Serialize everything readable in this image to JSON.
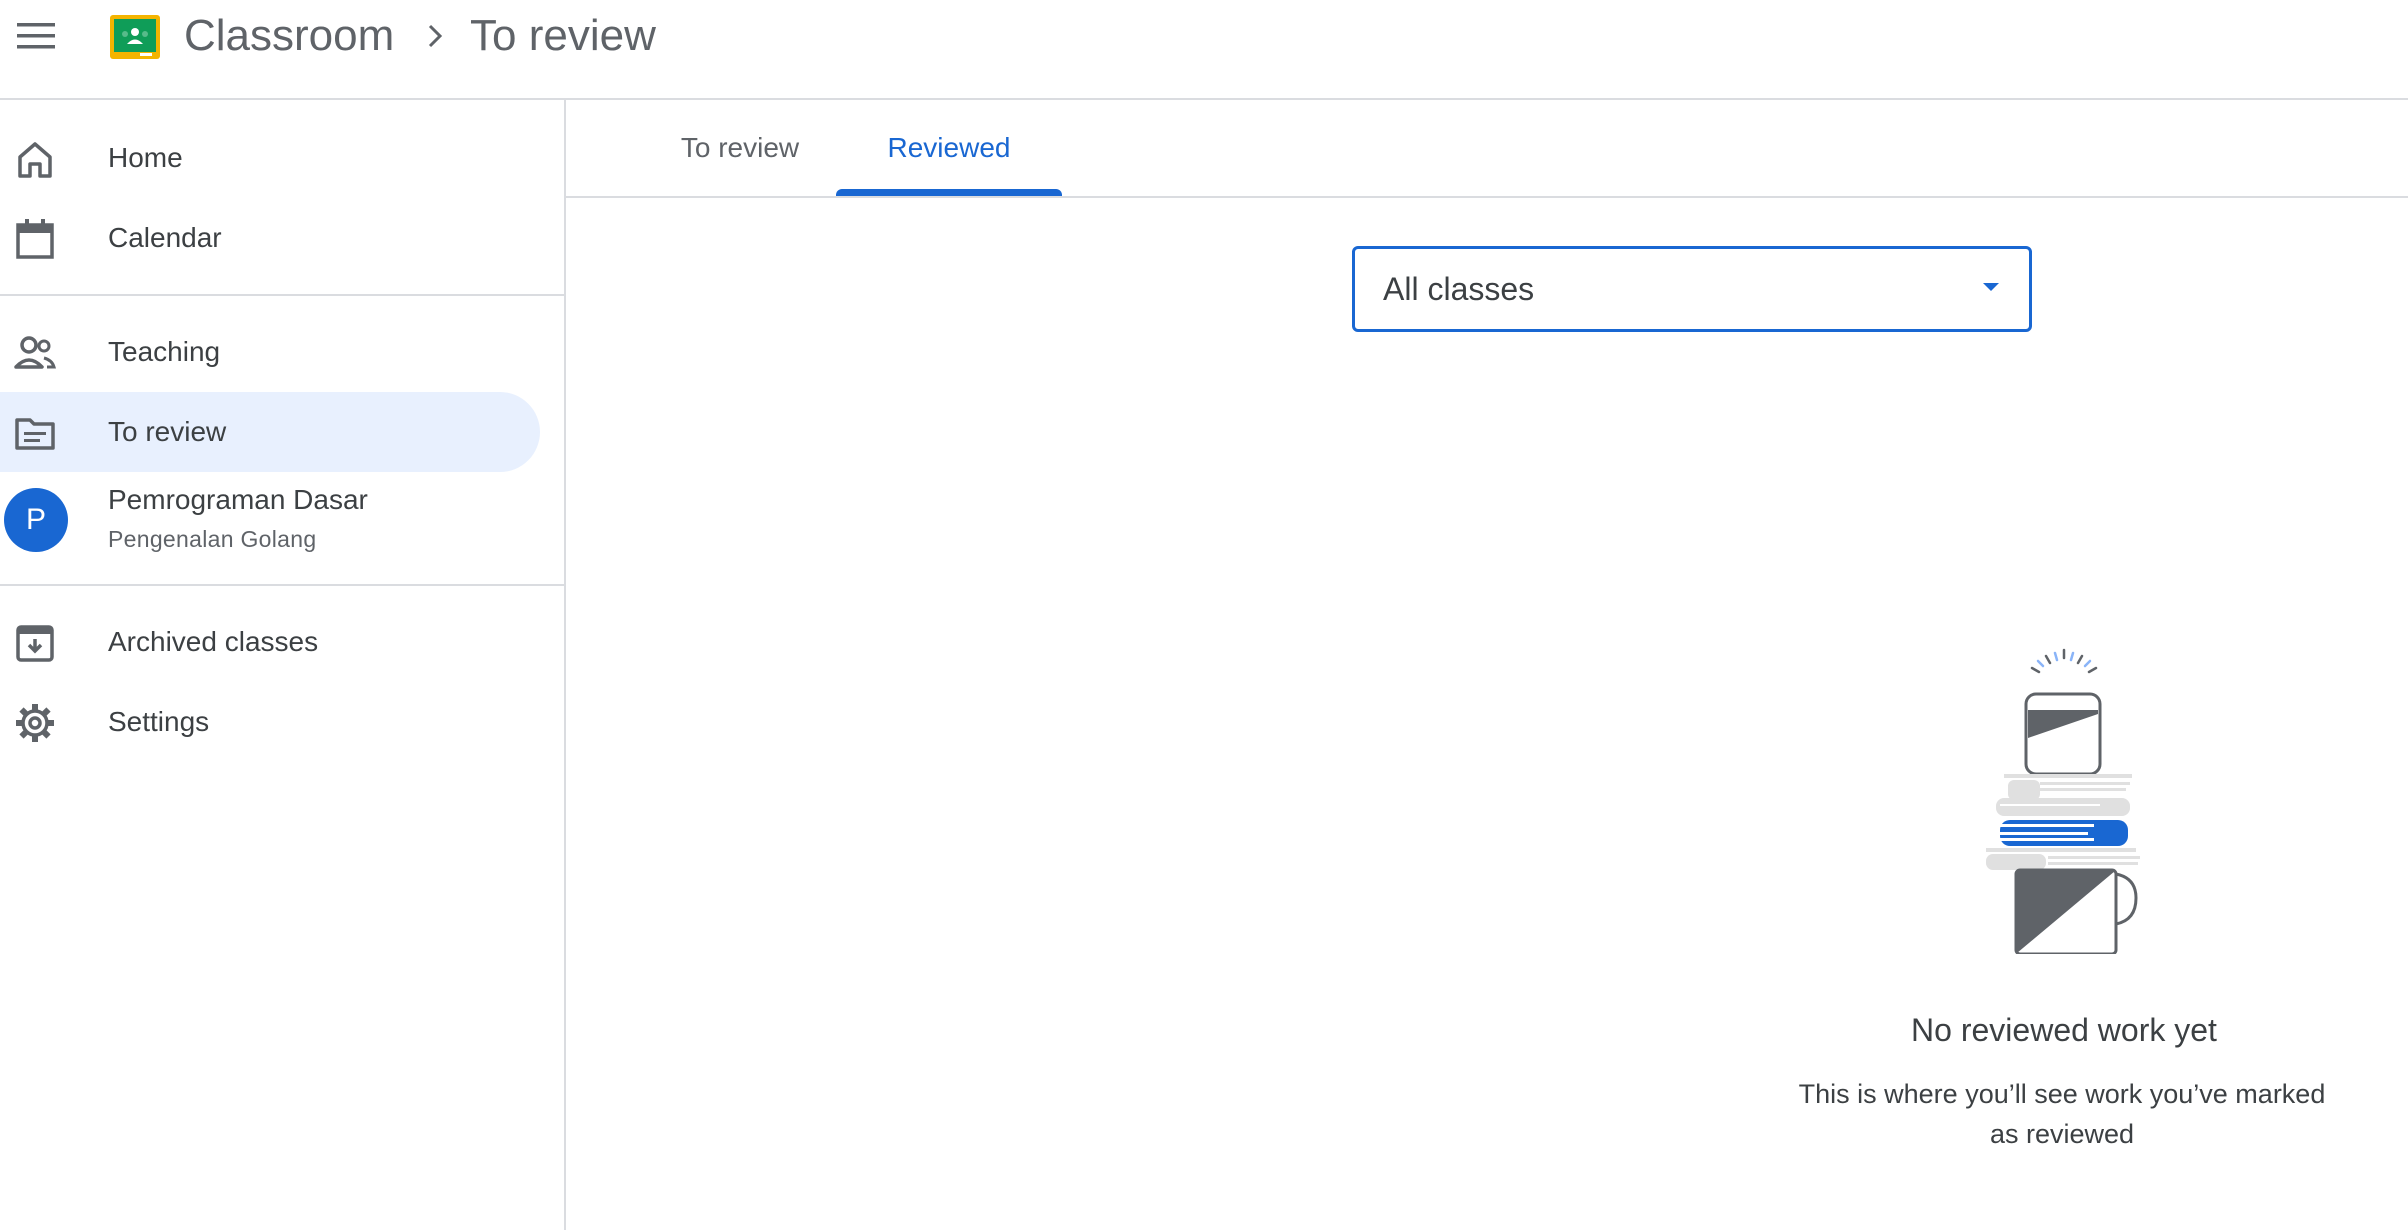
{
  "header": {
    "app_title": "Classroom",
    "breadcrumb_separator": "›",
    "current_page": "To review",
    "menu_icon": "hamburger-menu-icon",
    "logo_icon": "google-classroom-logo"
  },
  "sidebar": {
    "items": [
      {
        "label": "Home",
        "icon": "home-icon"
      },
      {
        "label": "Calendar",
        "icon": "calendar-icon"
      },
      {
        "label": "Teaching",
        "icon": "people-icon"
      },
      {
        "label": "To review",
        "icon": "review-folder-icon",
        "active": true
      },
      {
        "label": "Archived classes",
        "icon": "archive-icon"
      },
      {
        "label": "Settings",
        "icon": "gear-icon"
      }
    ],
    "class": {
      "avatar_letter": "P",
      "name": "Pemrograman Dasar",
      "section": "Pengenalan Golang",
      "avatar_color": "#1967d2"
    },
    "active_bg_color": "#e8f0fe"
  },
  "tabs": [
    {
      "label": "To review",
      "selected": false
    },
    {
      "label": "Reviewed",
      "selected": true
    }
  ],
  "filter": {
    "selected": "All classes"
  },
  "empty_state": {
    "title": "No reviewed work yet",
    "description": "This is where you’ll see work you’ve marked as reviewed",
    "illustration": "stacked-papers-coffee-mug-illustration"
  },
  "colors": {
    "accent": "#1967d2",
    "text": "#3c4043",
    "muted": "#5f6368",
    "divider": "#dadce0"
  }
}
